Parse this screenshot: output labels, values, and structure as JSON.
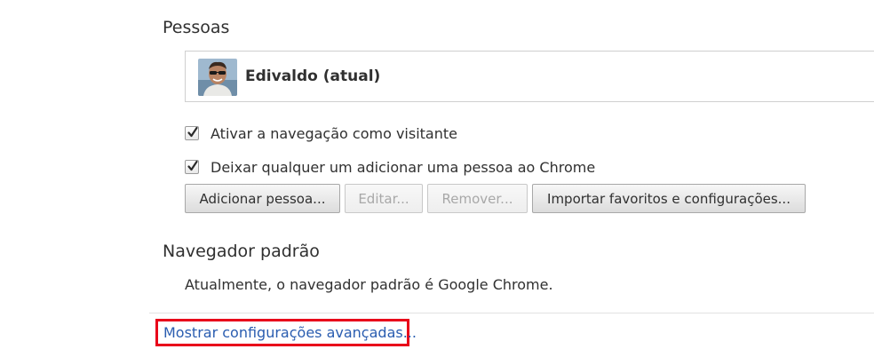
{
  "people": {
    "title": "Pessoas",
    "profile": {
      "name": "Edivaldo (atual)"
    },
    "options": [
      {
        "label": "Ativar a navegação como visitante",
        "checked": true
      },
      {
        "label": "Deixar qualquer um adicionar uma pessoa ao Chrome",
        "checked": true
      }
    ],
    "buttons": {
      "add": "Adicionar pessoa...",
      "edit": "Editar...",
      "remove": "Remover...",
      "import": "Importar favoritos e configurações..."
    }
  },
  "default_browser": {
    "title": "Navegador padrão",
    "status": "Atualmente, o navegador padrão é Google Chrome."
  },
  "advanced": {
    "link_label": "Mostrar configurações avançadas...",
    "highlight_color": "#e8001a"
  },
  "colors": {
    "link": "#2a5db0",
    "text": "#303030"
  }
}
